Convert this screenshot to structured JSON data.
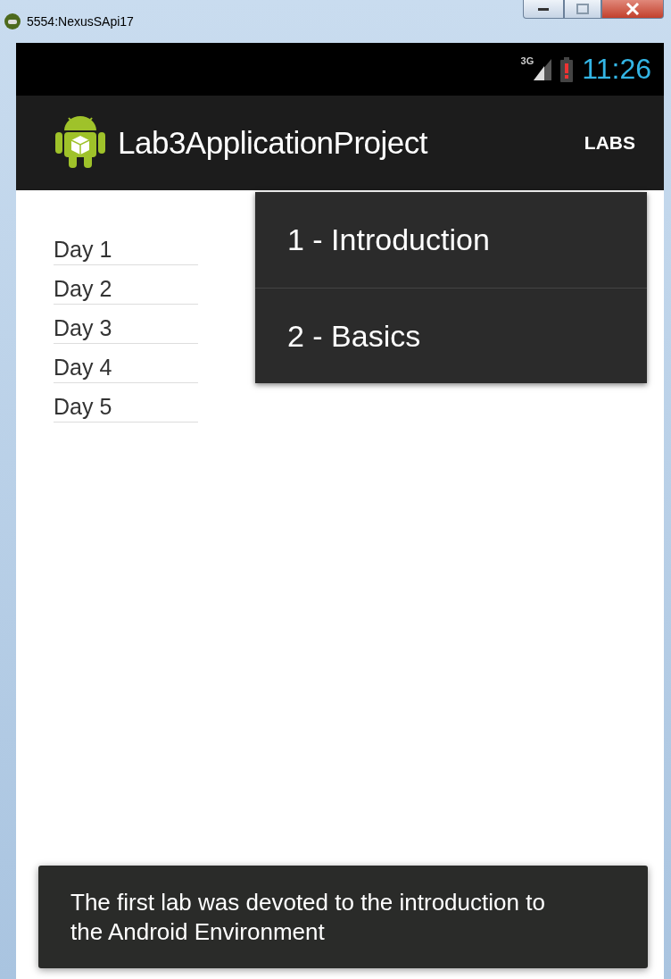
{
  "window": {
    "title": "5554:NexusSApi17"
  },
  "status_bar": {
    "network": "3G",
    "time": "11:26"
  },
  "action_bar": {
    "title": "Lab3ApplicationProject",
    "action": "LABS"
  },
  "days": [
    "Day 1",
    "Day 2",
    "Day 3",
    "Day 4",
    "Day 5"
  ],
  "menu": {
    "items": [
      "1 - Introduction",
      "2 - Basics"
    ]
  },
  "toast": {
    "text": "The first lab was devoted to the introduction to the Android Environment"
  }
}
